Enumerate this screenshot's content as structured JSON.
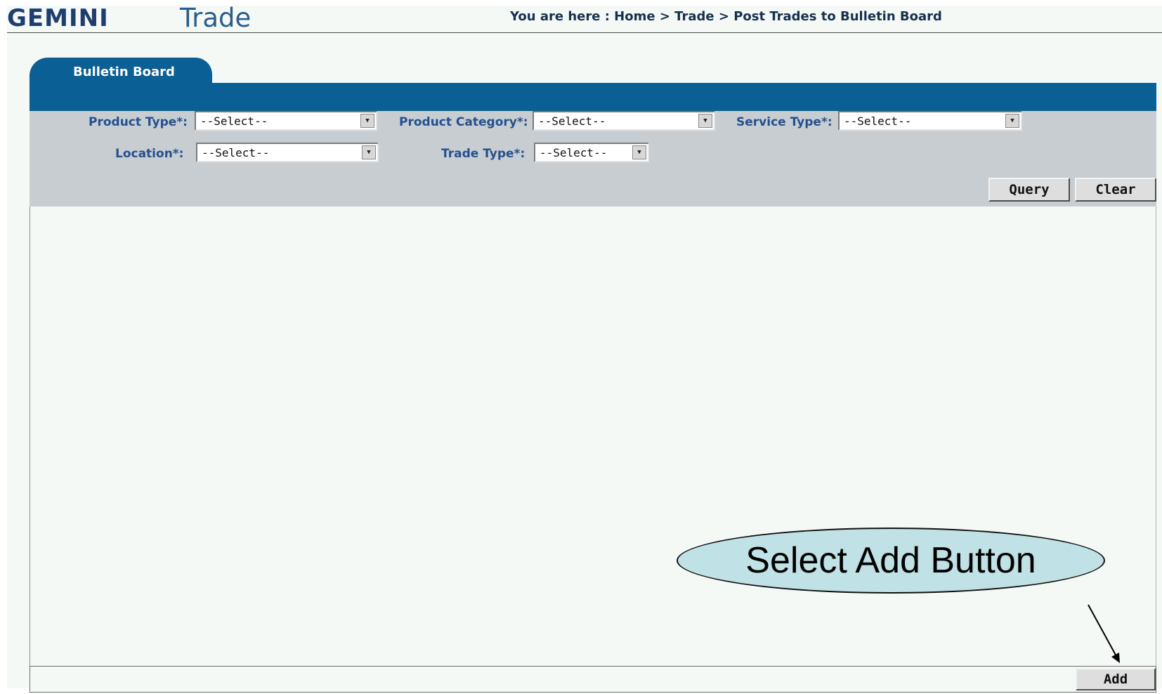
{
  "header": {
    "logo": "GEMINI",
    "module": "Trade",
    "breadcrumb": "You are here : Home > Trade > Post Trades to Bulletin Board"
  },
  "tab": {
    "label": "Bulletin Board"
  },
  "filters": {
    "product_type": {
      "label": "Product Type*:",
      "value": "--Select--"
    },
    "product_category": {
      "label": "Product Category*:",
      "value": "--Select--"
    },
    "service_type": {
      "label": "Service Type*:",
      "value": "--Select--"
    },
    "location": {
      "label": "Location*:",
      "value": "--Select--"
    },
    "trade_type": {
      "label": "Trade Type*:",
      "value": "--Select--"
    }
  },
  "buttons": {
    "query": "Query",
    "clear": "Clear",
    "add": "Add"
  },
  "callout": {
    "text": "Select Add Button"
  },
  "icons": {
    "dropdown": "chevron-down-icon",
    "arrow": "pointer-arrow-icon"
  },
  "colors": {
    "tab": "#0a5f94",
    "panel": "#c8cdd1",
    "label": "#24508f",
    "callout": "#c0e1e5"
  }
}
